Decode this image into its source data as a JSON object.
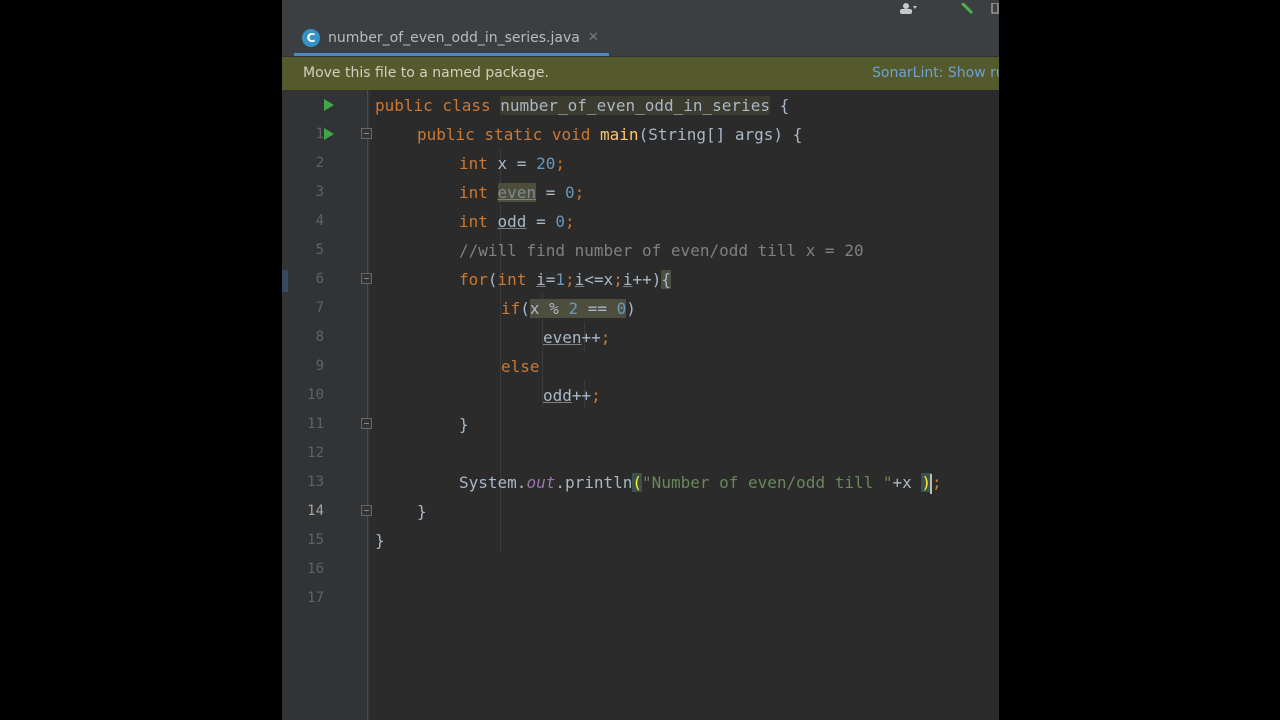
{
  "tab": {
    "filename": "number_of_even_odd_in_series.java",
    "icon_letter": "C"
  },
  "banner": {
    "message": "Move this file to a named package.",
    "link": "SonarLint: Show ru"
  },
  "editor": {
    "line_numbers": [
      "1",
      "2",
      "3",
      "4",
      "5",
      "6",
      "7",
      "8",
      "9",
      "10",
      "11",
      "12",
      "13",
      "14",
      "15",
      "16",
      "17"
    ],
    "current_line": "14",
    "code": {
      "l1_kw": "public class ",
      "l1_cls": "number_of_even_odd_in_series",
      "l1_rest": " {",
      "l2_kw": "public static void ",
      "l2_method": "main",
      "l2_rest": "(String[] args) {",
      "l3_kw": "int ",
      "l3_var": "x = ",
      "l3_num": "20",
      "l3_semi": ";",
      "l4_kw": "int ",
      "l4_var": "even",
      "l4_eq": " = ",
      "l4_num": "0",
      "l4_semi": ";",
      "l5_kw": "int ",
      "l5_var": "odd",
      "l5_eq": " = ",
      "l5_num": "0",
      "l5_semi": ";",
      "l6_comment": "//will find number of even/odd till x = 20",
      "l7_for": "for",
      "l7_p": "(",
      "l7_int": "int ",
      "l7_i1": "i",
      "l7_eq1": "=",
      "l7_one": "1",
      "l7_s1": ";",
      "l7_i2": "i",
      "l7_cmp": "<=x",
      "l7_s2": ";",
      "l7_i3": "i",
      "l7_inc": "++)",
      "l7_brace": "{",
      "l8_if": "if",
      "l8_p": "(",
      "l8_expr": "x % ",
      "l8_two": "2",
      "l8_eqeq": " == ",
      "l8_zero": "0",
      "l8_close": ")",
      "l9_var": "even",
      "l9_op": "++",
      "l9_semi": ";",
      "l10_else": "else",
      "l11_var": "odd",
      "l11_op": "++",
      "l11_semi": ";",
      "l12_close": "}",
      "l14_sys": "System.",
      "l14_out": "out",
      "l14_print": ".println",
      "l14_paren": "(",
      "l14_str": "\"Number of even/odd till \"",
      "l14_rest": "+x ",
      "l14_close": ")",
      "l14_semi": ";",
      "l15_close": "}",
      "l16_close": "}"
    }
  },
  "colors": {
    "keyword": "#cc7832",
    "number": "#6897bb",
    "string": "#6a8759",
    "comment": "#808080",
    "field": "#9876aa",
    "method": "#ffc66d",
    "text": "#a9b7c6",
    "banner": "#555a2c"
  }
}
